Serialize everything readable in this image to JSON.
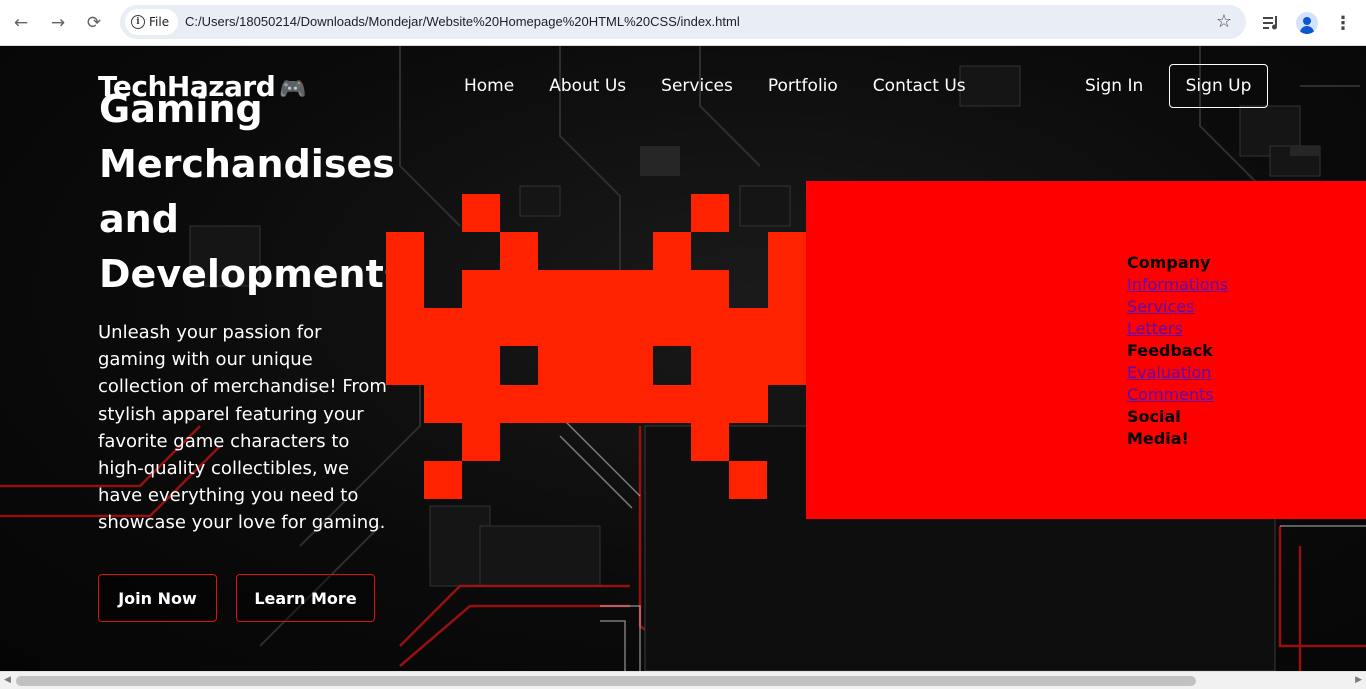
{
  "browser": {
    "chip_label": "File",
    "url": "C:/Users/18050214/Downloads/Mondejar/Website%20Homepage%20HTML%20CSS/index.html",
    "icons": [
      "back-arrow-icon",
      "forward-arrow-icon",
      "reload-icon",
      "info-icon",
      "star-icon",
      "media-icon",
      "profile-icon",
      "kebab-icon"
    ]
  },
  "site": {
    "brand": "TechHazard",
    "brand_icon": "🎮",
    "nav": [
      "Home",
      "About Us",
      "Services",
      "Portfolio",
      "Contact Us"
    ],
    "sign_in": "Sign In",
    "sign_up": "Sign Up"
  },
  "hero": {
    "title_lines": [
      "Gaming",
      "Merchandises",
      "and",
      "Developments"
    ],
    "text": "Unleash your passion for gaming with our unique collection of merchandise! From stylish apparel featuring your favorite game characters to high-quality collectibles, we have everything you need to showcase your love for gaming.",
    "join_label": "Join Now",
    "learn_label": "Learn More"
  },
  "menu": {
    "company_head": "Company",
    "company_links": [
      "Informations",
      "Services",
      "Letters"
    ],
    "feedback_head": "Feedback",
    "feedback_links": [
      "Evaluation",
      "Comments"
    ],
    "social_head_1": "Social",
    "social_head_2": "Media!"
  },
  "colors": {
    "accent_red": "#ff0000",
    "invader_red": "#ff2200",
    "button_border": "#e01010",
    "link_purple": "#5c0ab4"
  }
}
